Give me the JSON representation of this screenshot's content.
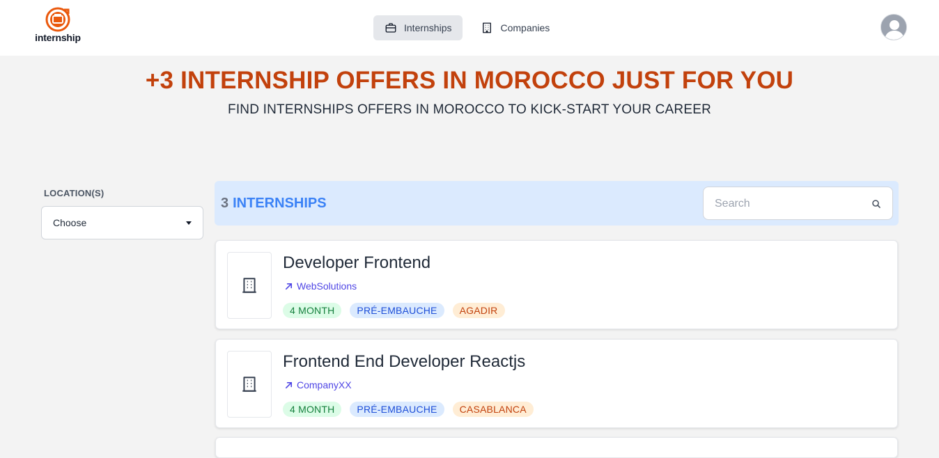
{
  "header": {
    "logo_text": "internship",
    "nav": [
      {
        "label": "Internships",
        "icon": "briefcase-icon",
        "active": true
      },
      {
        "label": "Companies",
        "icon": "building-icon",
        "active": false
      }
    ],
    "avatar_icon": "user-avatar-icon"
  },
  "hero": {
    "title": "+3 INTERNSHIP OFFERS IN MOROCCO JUST FOR YOU",
    "subtitle": "FIND INTERNSHIPS OFFERS IN MOROCCO TO KICK-START YOUR CAREER"
  },
  "filters": {
    "location_label": "LOCATION(S)",
    "location_value": "Choose"
  },
  "results": {
    "count": "3",
    "label": "INTERNSHIPS",
    "search_placeholder": "Search"
  },
  "listings": [
    {
      "title": "Developer Frontend",
      "company": "WebSolutions",
      "tags": [
        "4 MONTH",
        "PRÉ-EMBAUCHE",
        "AGADIR"
      ]
    },
    {
      "title": "Frontend End Developer Reactjs",
      "company": "CompanyXX",
      "tags": [
        "4 MONTH",
        "PRÉ-EMBAUCHE",
        "CASABLANCA"
      ]
    }
  ],
  "colors": {
    "accent": "#c2410c",
    "results_bar": "#dbeafe",
    "link": "#4f46e5"
  }
}
